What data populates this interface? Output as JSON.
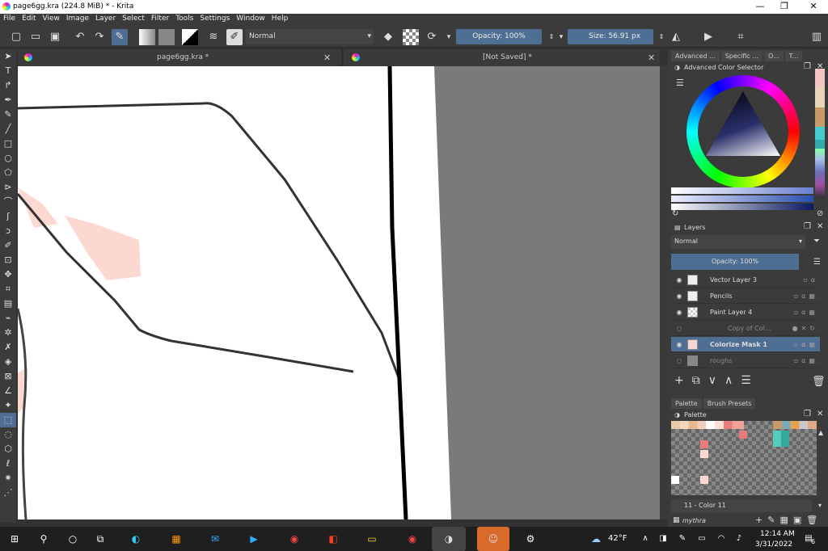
{
  "window": {
    "title": "page6gg.kra (224.8 MiB)  * - Krita",
    "min": "—",
    "max": "❐",
    "close": "✕"
  },
  "menu": [
    "File",
    "Edit",
    "View",
    "Image",
    "Layer",
    "Select",
    "Filter",
    "Tools",
    "Settings",
    "Window",
    "Help"
  ],
  "toolbar": {
    "blend_mode": "Normal",
    "opacity": "Opacity: 100%",
    "size_label": "Size:",
    "size_value": "56.91 px"
  },
  "tabs": [
    {
      "label": "page6gg.kra *"
    },
    {
      "label": "[Not Saved]  *"
    }
  ],
  "dock": {
    "tabs": [
      "Advanced ...",
      "Specific ...",
      "O...",
      "T..."
    ],
    "color_selector_title": "Advanced Color Selector",
    "layers_title": "Layers",
    "layers_blend": "Normal",
    "layers_opacity": "Opacity:  100%",
    "layers": [
      {
        "name": "Vector Layer 3",
        "visible": true,
        "selected": false
      },
      {
        "name": "Pencils",
        "visible": true,
        "selected": false
      },
      {
        "name": "Paint Layer 4",
        "visible": true,
        "selected": false
      },
      {
        "name": "Copy of Col...",
        "visible": false,
        "selected": false
      },
      {
        "name": "Colorize Mask 1",
        "visible": true,
        "selected": true
      },
      {
        "name": "roughs",
        "visible": false,
        "selected": false
      }
    ],
    "bottom_tabs": [
      "Palette",
      "Brush Presets"
    ],
    "palette_title": "Palette",
    "palette_color": "11 - Color 11",
    "palette_name": "mythra"
  },
  "taskbar": {
    "weather": "42°F",
    "time": "12:14 AM",
    "date": "3/31/2022",
    "notifications": "6"
  },
  "colors": {
    "accent": "#4f6e93",
    "panel": "#3b3b3b",
    "canvas_gray": "#7a7a7a"
  }
}
